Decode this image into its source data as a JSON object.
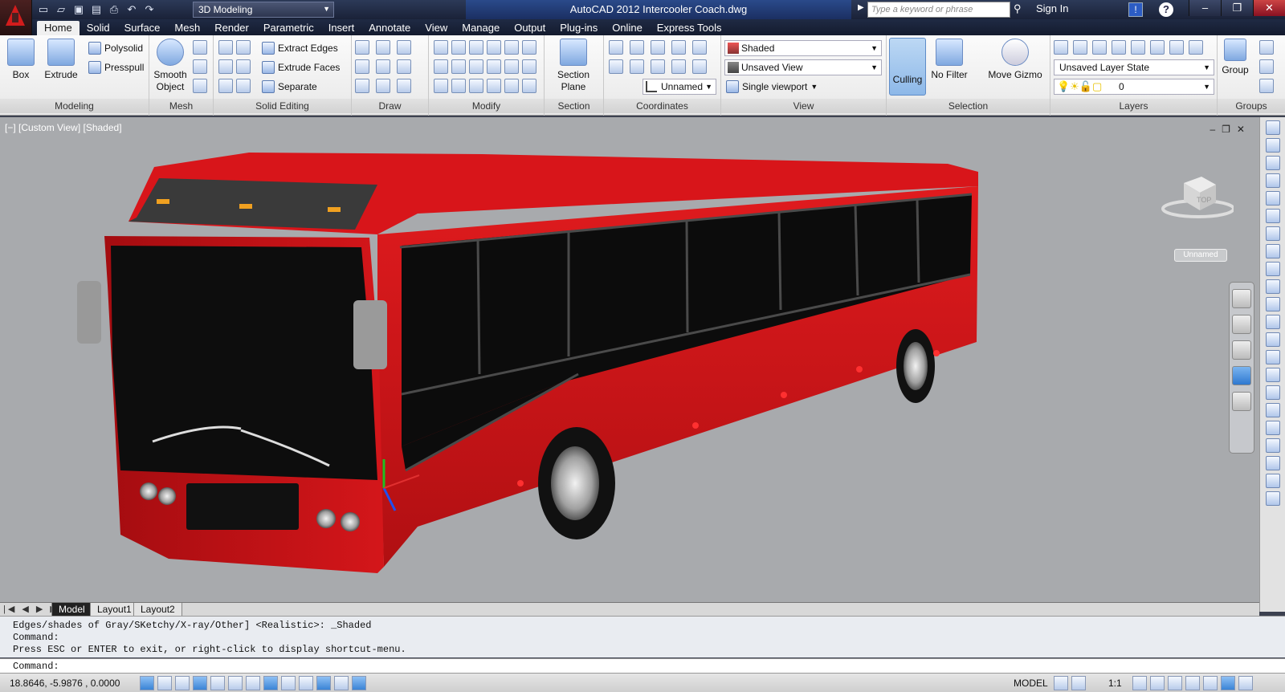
{
  "app": {
    "title": "AutoCAD 2012   Intercooler Coach.dwg",
    "workspace": "3D Modeling",
    "search_placeholder": "Type a keyword or phrase",
    "signin": "Sign In",
    "help": "?"
  },
  "tabs": [
    "Home",
    "Solid",
    "Surface",
    "Mesh",
    "Render",
    "Parametric",
    "Insert",
    "Annotate",
    "View",
    "Manage",
    "Output",
    "Plug-ins",
    "Online",
    "Express Tools"
  ],
  "ribbon": {
    "modeling": {
      "label": "Modeling",
      "box": "Box",
      "extrude": "Extrude",
      "polysolid": "Polysolid",
      "presspull": "Presspull"
    },
    "mesh": {
      "label": "Mesh",
      "smooth": "Smooth Object"
    },
    "solid_editing": {
      "label": "Solid Editing",
      "extract_edges": "Extract Edges",
      "extrude_faces": "Extrude Faces",
      "separate": "Separate"
    },
    "draw": {
      "label": "Draw"
    },
    "modify": {
      "label": "Modify"
    },
    "section": {
      "label": "Section",
      "section_plane": "Section Plane"
    },
    "coordinates": {
      "label": "Coordinates",
      "ucs_name": "Unnamed"
    },
    "view": {
      "label": "View",
      "visual_style": "Shaded",
      "saved_view": "Unsaved View",
      "viewport": "Single viewport"
    },
    "selection": {
      "label": "Selection",
      "culling": "Culling",
      "no_filter": "No Filter",
      "move_gizmo": "Move Gizmo"
    },
    "layers": {
      "label": "Layers",
      "layer_state": "Unsaved Layer State",
      "current_layer": "0"
    },
    "groups": {
      "label": "Groups",
      "group": "Group"
    }
  },
  "viewport": {
    "label": "[−] [Custom View] [Shaded]",
    "viewcube_face": "TOP",
    "ucs_badge": "Unnamed"
  },
  "layout_tabs": [
    "Model",
    "Layout1",
    "Layout2"
  ],
  "command": {
    "history": [
      "Edges/shades of Gray/SKetchy/X-ray/Other] <Realistic>: _Shaded",
      "Command:",
      "Press ESC or ENTER to exit, or right-click to display shortcut-menu."
    ],
    "prompt": "Command:"
  },
  "status": {
    "coords": "18.8646, -5.9876 , 0.0000",
    "model": "MODEL",
    "scale": "1:1"
  },
  "colors": {
    "bus_body": "#d0161a",
    "bus_windows": "#0e0e0e",
    "viewport_bg": "#a8aaad",
    "ribbon_accent": "#8db8e8"
  }
}
